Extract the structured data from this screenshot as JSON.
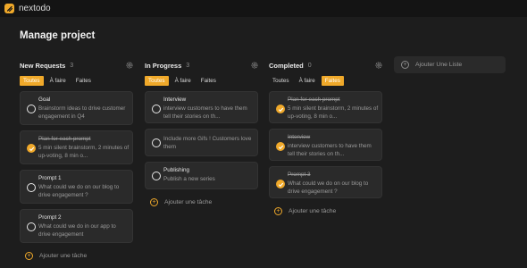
{
  "app": {
    "name": "nextodo"
  },
  "page": {
    "title": "Manage project"
  },
  "filters": [
    "Toutes",
    "À faire",
    "Faites"
  ],
  "add_task_label": "Ajouter une tâche",
  "add_list_label": "Ajouter Une Liste",
  "colors": {
    "accent": "#f0a92a",
    "background": "#1d1d1d",
    "card": "#2a2a2a",
    "topbar": "#141414"
  },
  "columns": [
    {
      "title": "New Requests",
      "count": "3",
      "active_filter": "Toutes",
      "cards": [
        {
          "title": "Goal",
          "desc": "Brainstorm ideas to drive customer engagement in Q4",
          "done": false
        },
        {
          "title": "Plan for each prompt",
          "desc": "5 min silent brainstorm, 2 minutes of up-voting, 8 min o...",
          "done": true
        },
        {
          "title": "Prompt 1",
          "desc": "What could we do on our blog to drive engagement ?",
          "done": false
        },
        {
          "title": "Prompt 2",
          "desc": "What could we do in our app to drive engagement",
          "done": false
        }
      ]
    },
    {
      "title": "In Progress",
      "count": "3",
      "active_filter": "Toutes",
      "cards": [
        {
          "title": "Interview",
          "desc": "interview customers to have them tell their stories on th...",
          "done": false
        },
        {
          "title": "",
          "desc": "Include more Gifs ! Customers love them",
          "done": false
        },
        {
          "title": "Publishing",
          "desc": "Publish a new series",
          "done": false
        }
      ]
    },
    {
      "title": "Completed",
      "count": "0",
      "active_filter": "Faites",
      "cards": [
        {
          "title": "Plan for each prompt",
          "desc": "5 min silent brainstorm, 2 minutes of up-voting, 8 min o...",
          "done": true
        },
        {
          "title": "Interview",
          "desc": "interview customers to have them tell their stories on th...",
          "done": true
        },
        {
          "title": "Prompt 3",
          "desc": "What could we do on our blog to drive engagement ?",
          "done": true
        }
      ]
    }
  ]
}
